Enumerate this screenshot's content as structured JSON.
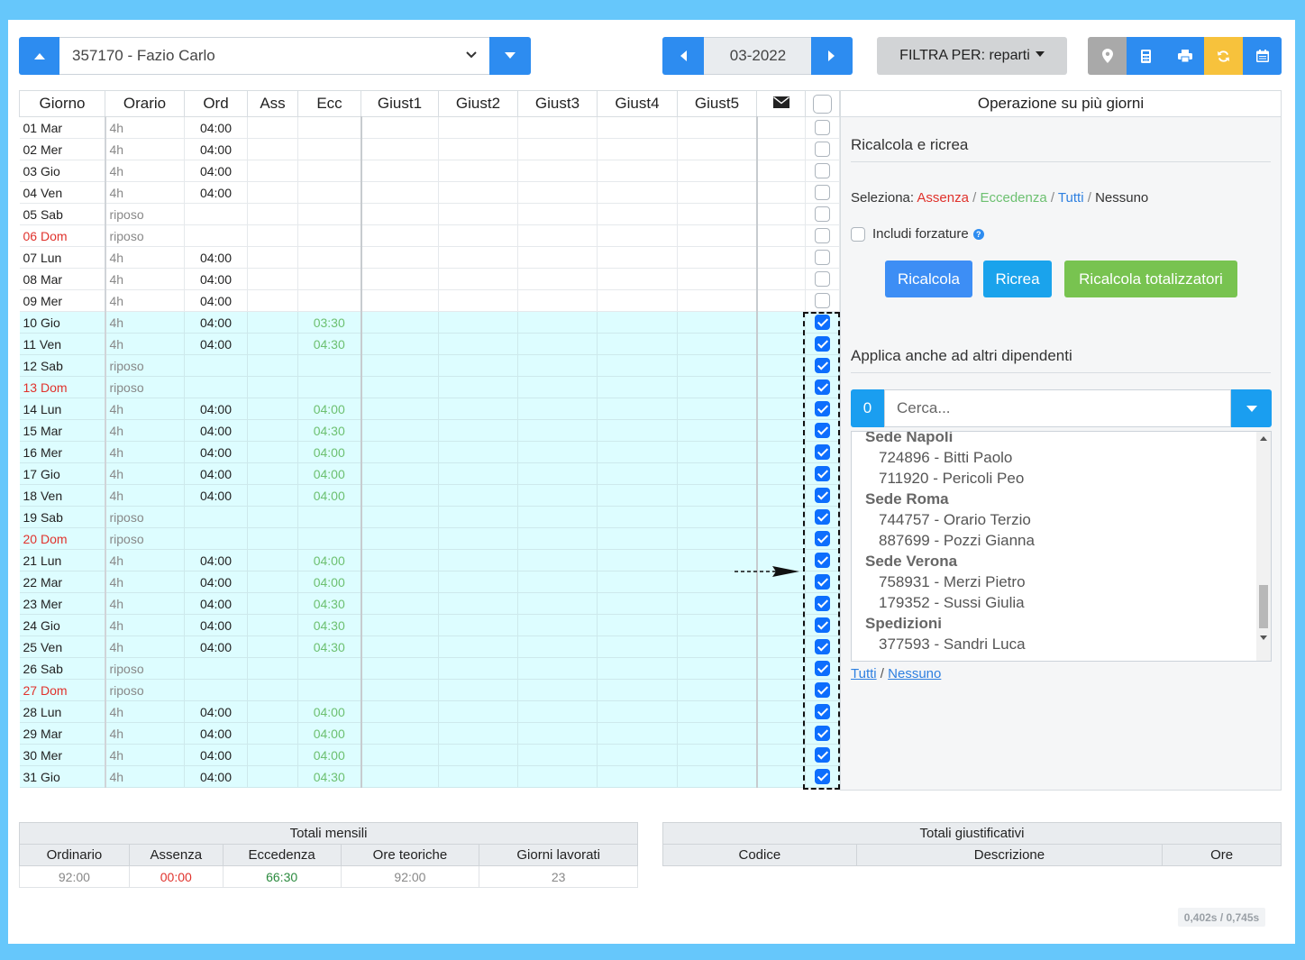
{
  "toolbar": {
    "employee": "357170 - Fazio Carlo",
    "month": "03-2022",
    "filter_label": "FILTRA PER: reparti",
    "icons": [
      "map-marker-icon",
      "calculator-icon",
      "print-icon",
      "refresh-icon",
      "calendar-icon"
    ],
    "colors": {
      "primary": "#2d8cf0",
      "warning": "#f7c23c",
      "secondary": "#a9a9a9"
    }
  },
  "table": {
    "headers": [
      "Giorno",
      "Orario",
      "Ord",
      "Ass",
      "Ecc",
      "Giust1",
      "Giust2",
      "Giust3",
      "Giust4",
      "Giust5"
    ],
    "rows": [
      {
        "giorno": "01 Mar",
        "orario": "4h",
        "ord": "04:00",
        "ecc": "",
        "dom": false,
        "checked": false
      },
      {
        "giorno": "02 Mer",
        "orario": "4h",
        "ord": "04:00",
        "ecc": "",
        "dom": false,
        "checked": false
      },
      {
        "giorno": "03 Gio",
        "orario": "4h",
        "ord": "04:00",
        "ecc": "",
        "dom": false,
        "checked": false
      },
      {
        "giorno": "04 Ven",
        "orario": "4h",
        "ord": "04:00",
        "ecc": "",
        "dom": false,
        "checked": false
      },
      {
        "giorno": "05 Sab",
        "orario": "riposo",
        "ord": "",
        "ecc": "",
        "dom": false,
        "checked": false
      },
      {
        "giorno": "06 Dom",
        "orario": "riposo",
        "ord": "",
        "ecc": "",
        "dom": true,
        "checked": false
      },
      {
        "giorno": "07 Lun",
        "orario": "4h",
        "ord": "04:00",
        "ecc": "",
        "dom": false,
        "checked": false
      },
      {
        "giorno": "08 Mar",
        "orario": "4h",
        "ord": "04:00",
        "ecc": "",
        "dom": false,
        "checked": false
      },
      {
        "giorno": "09 Mer",
        "orario": "4h",
        "ord": "04:00",
        "ecc": "",
        "dom": false,
        "checked": false
      },
      {
        "giorno": "10 Gio",
        "orario": "4h",
        "ord": "04:00",
        "ecc": "03:30",
        "dom": false,
        "checked": true
      },
      {
        "giorno": "11 Ven",
        "orario": "4h",
        "ord": "04:00",
        "ecc": "04:30",
        "dom": false,
        "checked": true
      },
      {
        "giorno": "12 Sab",
        "orario": "riposo",
        "ord": "",
        "ecc": "",
        "dom": false,
        "checked": true
      },
      {
        "giorno": "13 Dom",
        "orario": "riposo",
        "ord": "",
        "ecc": "",
        "dom": true,
        "checked": true
      },
      {
        "giorno": "14 Lun",
        "orario": "4h",
        "ord": "04:00",
        "ecc": "04:00",
        "dom": false,
        "checked": true
      },
      {
        "giorno": "15 Mar",
        "orario": "4h",
        "ord": "04:00",
        "ecc": "04:30",
        "dom": false,
        "checked": true
      },
      {
        "giorno": "16 Mer",
        "orario": "4h",
        "ord": "04:00",
        "ecc": "04:00",
        "dom": false,
        "checked": true
      },
      {
        "giorno": "17 Gio",
        "orario": "4h",
        "ord": "04:00",
        "ecc": "04:00",
        "dom": false,
        "checked": true
      },
      {
        "giorno": "18 Ven",
        "orario": "4h",
        "ord": "04:00",
        "ecc": "04:00",
        "dom": false,
        "checked": true
      },
      {
        "giorno": "19 Sab",
        "orario": "riposo",
        "ord": "",
        "ecc": "",
        "dom": false,
        "checked": true
      },
      {
        "giorno": "20 Dom",
        "orario": "riposo",
        "ord": "",
        "ecc": "",
        "dom": true,
        "checked": true
      },
      {
        "giorno": "21 Lun",
        "orario": "4h",
        "ord": "04:00",
        "ecc": "04:00",
        "dom": false,
        "checked": true
      },
      {
        "giorno": "22 Mar",
        "orario": "4h",
        "ord": "04:00",
        "ecc": "04:00",
        "dom": false,
        "checked": true
      },
      {
        "giorno": "23 Mer",
        "orario": "4h",
        "ord": "04:00",
        "ecc": "04:30",
        "dom": false,
        "checked": true
      },
      {
        "giorno": "24 Gio",
        "orario": "4h",
        "ord": "04:00",
        "ecc": "04:30",
        "dom": false,
        "checked": true
      },
      {
        "giorno": "25 Ven",
        "orario": "4h",
        "ord": "04:00",
        "ecc": "04:30",
        "dom": false,
        "checked": true
      },
      {
        "giorno": "26 Sab",
        "orario": "riposo",
        "ord": "",
        "ecc": "",
        "dom": false,
        "checked": true
      },
      {
        "giorno": "27 Dom",
        "orario": "riposo",
        "ord": "",
        "ecc": "",
        "dom": true,
        "checked": true
      },
      {
        "giorno": "28 Lun",
        "orario": "4h",
        "ord": "04:00",
        "ecc": "04:00",
        "dom": false,
        "checked": true
      },
      {
        "giorno": "29 Mar",
        "orario": "4h",
        "ord": "04:00",
        "ecc": "04:00",
        "dom": false,
        "checked": true
      },
      {
        "giorno": "30 Mer",
        "orario": "4h",
        "ord": "04:00",
        "ecc": "04:00",
        "dom": false,
        "checked": true
      },
      {
        "giorno": "31 Gio",
        "orario": "4h",
        "ord": "04:00",
        "ecc": "04:30",
        "dom": false,
        "checked": true
      }
    ]
  },
  "side": {
    "header": "Operazione su più giorni",
    "ricalcola_title": "Ricalcola e ricrea",
    "seleziona_label": "Seleziona:",
    "sel_assenza": "Assenza",
    "sel_eccedenza": "Eccedenza",
    "sel_tutti": "Tutti",
    "sel_nessuno": "Nessuno",
    "includi_forzature": "Includi forzature",
    "btn_ricalcola": "Ricalcola",
    "btn_ricrea": "Ricrea",
    "btn_totalizzatori": "Ricalcola totalizzatori",
    "applica_title": "Applica anche ad altri dipendenti",
    "count": "0",
    "search_placeholder": "Cerca...",
    "list": [
      {
        "group": "Sede Napoli",
        "items": [
          "724896 - Bitti Paolo",
          "711920 - Pericoli Peo"
        ]
      },
      {
        "group": "Sede Roma",
        "items": [
          "744757 - Orario Terzio",
          "887699 - Pozzi Gianna"
        ]
      },
      {
        "group": "Sede Verona",
        "items": [
          "758931 - Merzi Pietro",
          "179352 - Sussi Giulia"
        ]
      },
      {
        "group": "Spedizioni",
        "items": [
          "377593 - Sandri Luca"
        ]
      }
    ],
    "link_tutti": "Tutti",
    "link_nessuno": "Nessuno",
    "colors": {
      "ricalcola": "#3d8ef5",
      "ricrea": "#1aa3ec",
      "totalizzatori": "#78c350"
    }
  },
  "totali_mensili": {
    "title": "Totali mensili",
    "headers": [
      "Ordinario",
      "Assenza",
      "Eccedenza",
      "Ore teoriche",
      "Giorni lavorati"
    ],
    "values": [
      "92:00",
      "00:00",
      "66:30",
      "92:00",
      "23"
    ]
  },
  "totali_giustificativi": {
    "title": "Totali giustificativi",
    "headers": [
      "Codice",
      "Descrizione",
      "Ore"
    ]
  },
  "timer": "0,402s / 0,745s"
}
